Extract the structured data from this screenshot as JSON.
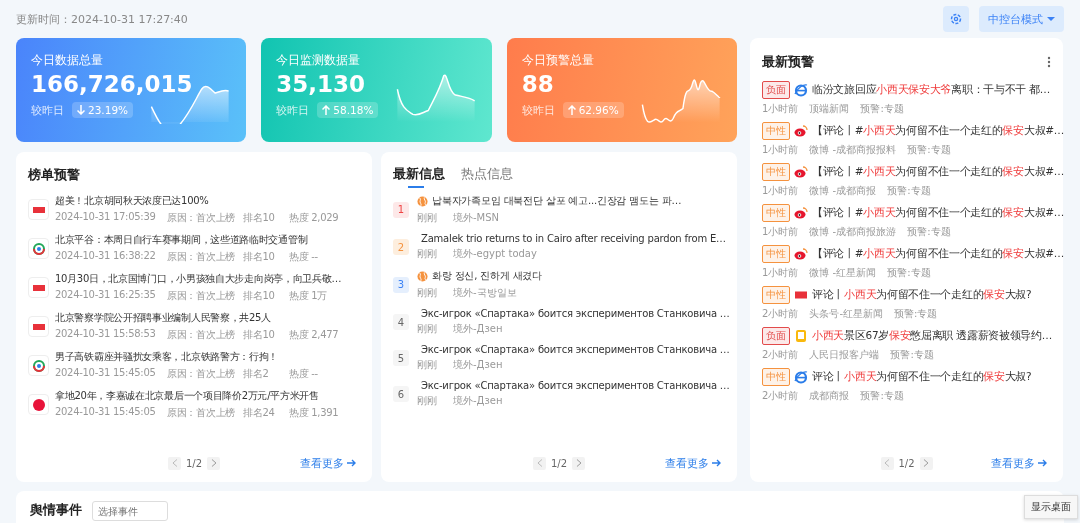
{
  "header": {
    "update_time": "更新时间：2024-10-31 17:27:40",
    "mode_button": "中控台模式"
  },
  "stat_cards": [
    {
      "kind": "down",
      "title": "今日数据总量",
      "value": "166,726,015",
      "compare_label": "较昨日",
      "change": "23.19%"
    },
    {
      "kind": "up",
      "title": "今日监测数据量",
      "value": "35,130",
      "compare_label": "较昨日",
      "change": "58.18%"
    },
    {
      "kind": "up",
      "title": "今日预警总量",
      "value": "88",
      "compare_label": "较昨日",
      "change": "62.96%"
    }
  ],
  "ranking_panel": {
    "title": "榜单预警",
    "items": [
      {
        "kind": "toutiao",
        "title": "超美！北京胡同秋天浓度已达100%",
        "time": "2024-10-31 17:05:39",
        "reason": "原因：首次上榜",
        "rank": "排名10",
        "heat": "热度 2,029"
      },
      {
        "kind": "qqnews",
        "title": "北京平谷：本周日自行车赛事期间，这些道路临时交通管制",
        "time": "2024-10-31 16:38:22",
        "reason": "原因：首次上榜",
        "rank": "排名10",
        "heat": "热度 --"
      },
      {
        "kind": "toutiao",
        "title": "10月30日，北京国博门口，小男孩独自大步走向岗亭，向卫兵敬…",
        "time": "2024-10-31 16:25:35",
        "reason": "原因：首次上榜",
        "rank": "排名10",
        "heat": "热度 1万"
      },
      {
        "kind": "toutiao",
        "title": "北京警察学院公开招聘事业编制人民警察，共25人",
        "time": "2024-10-31 15:58:53",
        "reason": "原因：首次上榜",
        "rank": "排名10",
        "heat": "热度 2,477"
      },
      {
        "kind": "qqnews",
        "title": "男子高铁霸座并骚扰女乘客，北京铁路警方：行拘！",
        "time": "2024-10-31 15:45:05",
        "reason": "原因：首次上榜",
        "rank": "排名2",
        "heat": "热度 --"
      },
      {
        "kind": "netease",
        "title": "拿地20年，李嘉诚在北京最后一个项目降价2万元/平方米开售",
        "time": "2024-10-31 15:45:05",
        "reason": "原因：首次上榜",
        "rank": "排名24",
        "heat": "热度 1,391"
      }
    ],
    "pager": "1/2",
    "more": "查看更多"
  },
  "info_panel": {
    "tabs": [
      {
        "label": "最新信息",
        "selected": true
      },
      {
        "label": "热点信息",
        "selected": false
      }
    ],
    "items": [
      {
        "rank": "1",
        "title": "납북자가족모임 대북전단 살포 예고...긴장감 맴도는 파…",
        "time": "刚刚",
        "source": "境外-MSN"
      },
      {
        "rank": "2",
        "title": "Zamalek trio returns to in Cairo after receiving pardon from E…",
        "time": "刚刚",
        "source": "境外-egypt today"
      },
      {
        "rank": "3",
        "title": "화랑 정신, 진하게 새겼다",
        "time": "刚刚",
        "source": "境外-국방일보"
      },
      {
        "rank": "4",
        "title": "Экс-игрок «Спартака» боится экспериментов Станковича …",
        "time": "刚刚",
        "source": "境外-Дзен"
      },
      {
        "rank": "5",
        "title": "Экс-игрок «Спартака» боится экспериментов Станковича …",
        "time": "刚刚",
        "source": "境外-Дзен"
      },
      {
        "rank": "6",
        "title": "Экс-игрок «Спартака» боится экспериментов Станковича …",
        "time": "刚刚",
        "source": "境外-Дзен"
      }
    ],
    "pager": "1/2",
    "more": "查看更多"
  },
  "alert_panel": {
    "title": "最新预警",
    "items": [
      {
        "tag": "负面",
        "color": "#e24b4b",
        "kind": "ie",
        "title": [
          {
            "text": "临汾文旅回应",
            "highlight": false
          },
          {
            "text": "小西天保安大爷",
            "highlight": true
          },
          {
            "text": "离职：干与不干 都…",
            "highlight": false
          }
        ],
        "time": "1小时前",
        "source": "顶端新闻",
        "alert": "预警:专题"
      },
      {
        "tag": "中性",
        "color": "#f5923e",
        "kind": "weibo",
        "title": [
          {
            "text": "【评论丨#",
            "highlight": false
          },
          {
            "text": "小西天",
            "highlight": true
          },
          {
            "text": "为何留不住一个走红的",
            "highlight": false
          },
          {
            "text": "保安",
            "highlight": true
          },
          {
            "text": "大叔#…",
            "highlight": false
          }
        ],
        "time": "1小时前",
        "source": "微博 -成都商报报料",
        "alert": "预警:专题"
      },
      {
        "tag": "中性",
        "color": "#f5923e",
        "kind": "weibo",
        "title": [
          {
            "text": "【评论丨#",
            "highlight": false
          },
          {
            "text": "小西天",
            "highlight": true
          },
          {
            "text": "为何留不住一个走红的",
            "highlight": false
          },
          {
            "text": "保安",
            "highlight": true
          },
          {
            "text": "大叔#…",
            "highlight": false
          }
        ],
        "time": "1小时前",
        "source": "微博 -成都商报",
        "alert": "预警:专题"
      },
      {
        "tag": "中性",
        "color": "#f5923e",
        "kind": "weibo",
        "title": [
          {
            "text": "【评论丨#",
            "highlight": false
          },
          {
            "text": "小西天",
            "highlight": true
          },
          {
            "text": "为何留不住一个走红的",
            "highlight": false
          },
          {
            "text": "保安",
            "highlight": true
          },
          {
            "text": "大叔#…",
            "highlight": false
          }
        ],
        "time": "1小时前",
        "source": "微博 -成都商报旅游",
        "alert": "预警:专题"
      },
      {
        "tag": "中性",
        "color": "#f5923e",
        "kind": "weibo",
        "title": [
          {
            "text": "【评论丨#",
            "highlight": false
          },
          {
            "text": "小西天",
            "highlight": true
          },
          {
            "text": "为何留不住一个走红的",
            "highlight": false
          },
          {
            "text": "保安",
            "highlight": true
          },
          {
            "text": "大叔#…",
            "highlight": false
          }
        ],
        "time": "1小时前",
        "source": "微博 -红星新闻",
        "alert": "预警:专题"
      },
      {
        "tag": "中性",
        "color": "#f5923e",
        "kind": "toutiao",
        "title": [
          {
            "text": "评论丨",
            "highlight": false
          },
          {
            "text": "小西天",
            "highlight": true
          },
          {
            "text": "为何留不住一个走红的",
            "highlight": false
          },
          {
            "text": "保安",
            "highlight": true
          },
          {
            "text": "大叔?",
            "highlight": false
          }
        ],
        "time": "2小时前",
        "source": "头条号-红星新闻",
        "alert": "预警:专题"
      },
      {
        "tag": "负面",
        "color": "#e24b4b",
        "kind": "app",
        "title": [
          {
            "text": "小西天",
            "highlight": true
          },
          {
            "text": "景区67岁",
            "highlight": false
          },
          {
            "text": "保安",
            "highlight": true
          },
          {
            "text": "憋屈离职 透露薪资被领导约…",
            "highlight": false
          }
        ],
        "time": "2小时前",
        "source": "人民日报客户端",
        "alert": "预警:专题"
      },
      {
        "tag": "中性",
        "color": "#f5923e",
        "kind": "ie",
        "title": [
          {
            "text": "评论丨",
            "highlight": false
          },
          {
            "text": "小西天",
            "highlight": true
          },
          {
            "text": "为何留不住一个走红的",
            "highlight": false
          },
          {
            "text": "保安",
            "highlight": true
          },
          {
            "text": "大叔?",
            "highlight": false
          }
        ],
        "time": "2小时前",
        "source": "成都商报",
        "alert": "预警:专题"
      }
    ],
    "pager": "1/2",
    "more": "查看更多"
  },
  "event_panel": {
    "title": "舆情事件",
    "select": {
      "placeholder": "选择事件"
    }
  },
  "tooltip": "显示桌面"
}
